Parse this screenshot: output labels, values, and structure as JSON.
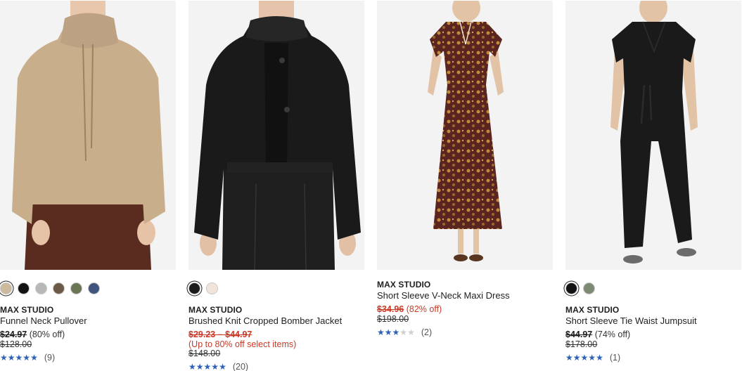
{
  "products": [
    {
      "brand": "MAX STUDIO",
      "title": "Funnel Neck Pullover",
      "price": "$24.97",
      "discount": "(80% off)",
      "original_price": "$128.00",
      "rating": 5,
      "reviews": "(9)",
      "swatches": [
        "#cdb99c",
        "#121212",
        "#b8b8b8",
        "#6b5a45",
        "#6a7654",
        "#3f557d"
      ],
      "selected_swatch": 0,
      "image_icon": "funnel-neck-pullover-image"
    },
    {
      "brand": "MAX STUDIO",
      "title": "Brushed Knit Cropped Bomber Jacket",
      "price": "$29.23 – $44.97",
      "promo": "(Up to 80% off select items)",
      "original_price": "$148.00",
      "rating": 5,
      "reviews": "(20)",
      "swatches": [
        "#1a1a1a",
        "#f1e4da"
      ],
      "selected_swatch": 0,
      "image_icon": "bomber-jacket-image"
    },
    {
      "brand": "MAX STUDIO",
      "title": "Short Sleeve V-Neck Maxi Dress",
      "price": "$34.96",
      "discount": "(82% off)",
      "original_price": "$198.00",
      "rating": 3,
      "reviews": "(2)",
      "swatches": [],
      "image_icon": "maxi-dress-image"
    },
    {
      "brand": "MAX STUDIO",
      "title": "Short Sleeve Tie Waist Jumpsuit",
      "price": "$44.97",
      "discount": "(74% off)",
      "original_price": "$178.00",
      "rating": 5,
      "reviews": "(1)",
      "swatches": [
        "#121212",
        "#7d8a74"
      ],
      "selected_swatch": 0,
      "image_icon": "jumpsuit-image"
    }
  ],
  "colors": {
    "sale_red": "#c93a27",
    "star_blue": "#2e62b6",
    "image_bg": "#f2f2f2"
  }
}
